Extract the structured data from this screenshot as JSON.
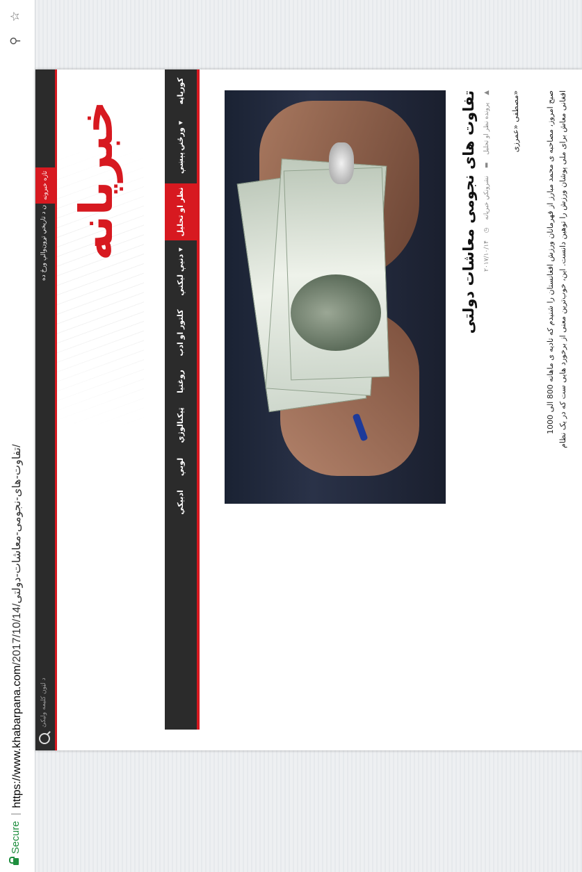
{
  "browser": {
    "secure_label": "Secure",
    "url_host": "https://www.khabarpana.com",
    "url_path": "/2017/10/14/تفاوت-های-نجومی-معاشات-دولتی/"
  },
  "topbar": {
    "search_placeholder": "د لټون کلیمه ولیکئ",
    "ticker_text": "ن د تاریخي تړون‌والې ورځ ده",
    "ticker_badge": "تازه خبرونه"
  },
  "logo": {
    "text": "خبرپانه"
  },
  "nav": {
    "items": [
      {
        "label": "کورپاڼه"
      },
      {
        "label": "ورځنۍ پېښې ▾"
      },
      {
        "label": "نظر او تحلیل"
      },
      {
        "label": "دنیې لیکنې ▾"
      },
      {
        "label": "کلتور او ادب"
      },
      {
        "label": "روغتیا"
      },
      {
        "label": "ټیکنالوژي"
      },
      {
        "label": "لوبې"
      },
      {
        "label": "ادبیکي"
      }
    ],
    "active_index": 2
  },
  "article": {
    "title": "تفاوت های نجومی معاشات دولتی",
    "meta_author": "نشرونکي خبرپانه",
    "meta_category": "پرونده نظر او تحلیل",
    "meta_date": "۲۰۱۷/۱۰/۱۴",
    "author_line": "مصطفی «عمرزی»",
    "body_line1": "صبح امروز، مصاحبه ی محمد مبارز از قهرمانان ورزش افغانستان را شنیدم که تادیه ی ماهانه 800 الی 1000",
    "body_line2": "افغانی معاش برای ملی پوشان ورزش را توهین دانست. این، خوب‌ترین معنی از برخورد هایی ست که در یک نظام"
  },
  "colors": {
    "accent": "#d71920",
    "nav_bg": "#2b2b2b",
    "secure": "#1e8e3e"
  }
}
